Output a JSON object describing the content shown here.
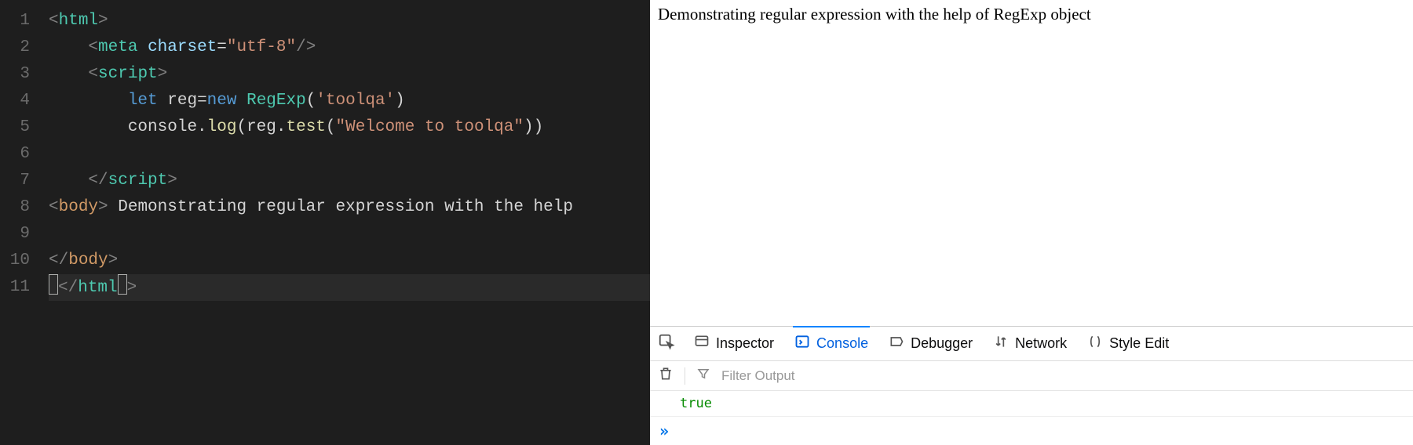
{
  "editor": {
    "line_numbers": [
      "1",
      "2",
      "3",
      "4",
      "5",
      "6",
      "7",
      "8",
      "9",
      "10",
      "11"
    ],
    "lines": [
      {
        "indent": 0,
        "tokens": [
          {
            "t": "<",
            "c": "tok-angle"
          },
          {
            "t": "html",
            "c": "tok-tag"
          },
          {
            "t": ">",
            "c": "tok-angle"
          }
        ]
      },
      {
        "indent": 1,
        "tokens": [
          {
            "t": "<",
            "c": "tok-angle"
          },
          {
            "t": "meta",
            "c": "tok-tag"
          },
          {
            "t": " ",
            "c": ""
          },
          {
            "t": "charset",
            "c": "tok-attr"
          },
          {
            "t": "=",
            "c": "tok-op"
          },
          {
            "t": "\"utf-8\"",
            "c": "tok-str"
          },
          {
            "t": "/>",
            "c": "tok-angle"
          }
        ]
      },
      {
        "indent": 1,
        "tokens": [
          {
            "t": "<",
            "c": "tok-angle"
          },
          {
            "t": "script",
            "c": "tok-tag"
          },
          {
            "t": ">",
            "c": "tok-angle"
          }
        ]
      },
      {
        "indent": 2,
        "tokens": [
          {
            "t": "let",
            "c": "tok-kw"
          },
          {
            "t": " ",
            "c": ""
          },
          {
            "t": "reg",
            "c": "tok-id"
          },
          {
            "t": "=",
            "c": "tok-op"
          },
          {
            "t": "new",
            "c": "tok-kw"
          },
          {
            "t": " ",
            "c": ""
          },
          {
            "t": "RegExp",
            "c": "tok-type"
          },
          {
            "t": "(",
            "c": "tok-op"
          },
          {
            "t": "'toolqa'",
            "c": "tok-str"
          },
          {
            "t": ")",
            "c": "tok-op"
          }
        ]
      },
      {
        "indent": 2,
        "tokens": [
          {
            "t": "console",
            "c": "tok-id"
          },
          {
            "t": ".",
            "c": "tok-op"
          },
          {
            "t": "log",
            "c": "tok-fn"
          },
          {
            "t": "(",
            "c": "tok-op"
          },
          {
            "t": "reg",
            "c": "tok-id"
          },
          {
            "t": ".",
            "c": "tok-op"
          },
          {
            "t": "test",
            "c": "tok-fn"
          },
          {
            "t": "(",
            "c": "tok-op"
          },
          {
            "t": "\"Welcome to toolqa\"",
            "c": "tok-str"
          },
          {
            "t": "))",
            "c": "tok-op"
          }
        ]
      },
      {
        "indent": 2,
        "tokens": []
      },
      {
        "indent": 1,
        "tokens": [
          {
            "t": "</",
            "c": "tok-angle"
          },
          {
            "t": "script",
            "c": "tok-tag"
          },
          {
            "t": ">",
            "c": "tok-angle"
          }
        ]
      },
      {
        "indent": 0,
        "tokens": [
          {
            "t": "<",
            "c": "tok-angle"
          },
          {
            "t": "body",
            "c": "tok-body"
          },
          {
            "t": ">",
            "c": "tok-angle"
          },
          {
            "t": " Demonstrating regular expression with the help ",
            "c": "tok-text"
          }
        ]
      },
      {
        "indent": 0,
        "tokens": []
      },
      {
        "indent": 0,
        "tokens": [
          {
            "t": "</",
            "c": "tok-angle"
          },
          {
            "t": "body",
            "c": "tok-body"
          },
          {
            "t": ">",
            "c": "tok-angle"
          }
        ]
      },
      {
        "indent": 0,
        "cursor": true,
        "tokens_split": {
          "pre": [
            {
              "t": "<",
              "c": "tok-angle"
            }
          ],
          "mid": [
            {
              "t": "/",
              "c": "tok-angle"
            },
            {
              "t": "html",
              "c": "tok-tag"
            }
          ],
          "post": [
            {
              "t": ">",
              "c": "tok-angle"
            }
          ]
        }
      }
    ]
  },
  "page": {
    "body_text": "Demonstrating regular expression with the help of RegExp object"
  },
  "devtools": {
    "tabs": {
      "inspector": "Inspector",
      "console": "Console",
      "debugger": "Debugger",
      "network": "Network",
      "style": "Style Edit"
    },
    "filter_placeholder": "Filter Output",
    "console_output": "true",
    "prompt": "»"
  }
}
